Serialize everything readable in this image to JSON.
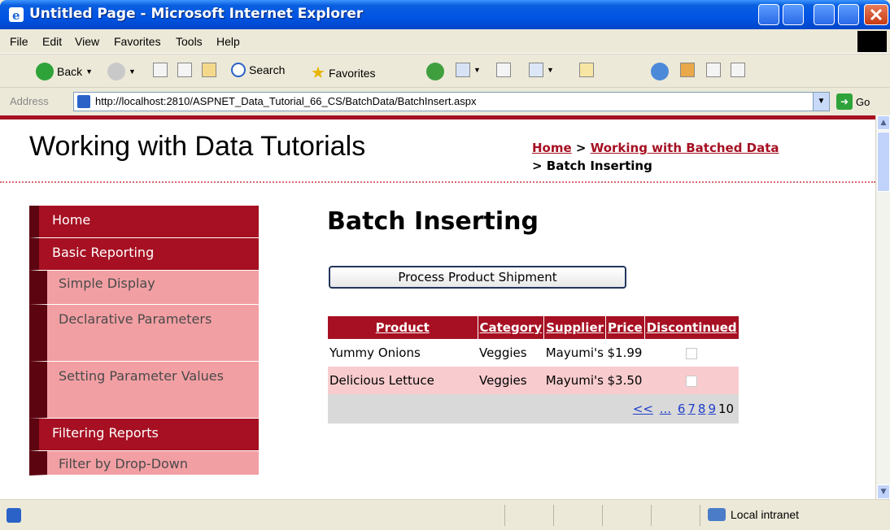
{
  "window": {
    "title": "Untitled Page - Microsoft Internet Explorer"
  },
  "menubar": {
    "items": [
      "File",
      "Edit",
      "View",
      "Favorites",
      "Tools",
      "Help"
    ]
  },
  "toolbar": {
    "back": "Back",
    "search": "Search",
    "favorites": "Favorites"
  },
  "address": {
    "label": "Address",
    "url": "http://localhost:2810/ASPNET_Data_Tutorial_66_CS/BatchData/BatchInsert.aspx",
    "go": "Go"
  },
  "site": {
    "title": "Working with Data Tutorials"
  },
  "breadcrumb": {
    "home": "Home",
    "sep1": " > ",
    "section": "Working with Batched Data",
    "sep2": "> ",
    "current": "Batch Inserting"
  },
  "menu": {
    "home": "Home",
    "basic_reporting": "Basic Reporting",
    "simple_display": "Simple Display",
    "declarative_parameters": "Declarative Parameters",
    "setting_parameter_values": "Setting Parameter Values",
    "filtering_reports": "Filtering Reports",
    "partial_item": "Filter by Drop-Down"
  },
  "page": {
    "heading": "Batch Inserting",
    "process_button": "Process Product Shipment"
  },
  "grid": {
    "headers": {
      "product": "Product",
      "category": "Category",
      "supplier": "Supplier",
      "price": "Price",
      "discontinued": "Discontinued"
    },
    "rows": [
      {
        "product": "Yummy Onions",
        "category": "Veggies",
        "supplier": "Mayumi's",
        "price": "$1.99",
        "discontinued": false
      },
      {
        "product": "Delicious Lettuce",
        "category": "Veggies",
        "supplier": "Mayumi's",
        "price": "$3.50",
        "discontinued": false
      }
    ],
    "pager": {
      "first": "<<",
      "ellipsis": "...",
      "pages": [
        "6",
        "7",
        "8",
        "9"
      ],
      "current": "10"
    }
  },
  "status": {
    "zone": "Local intranet"
  }
}
